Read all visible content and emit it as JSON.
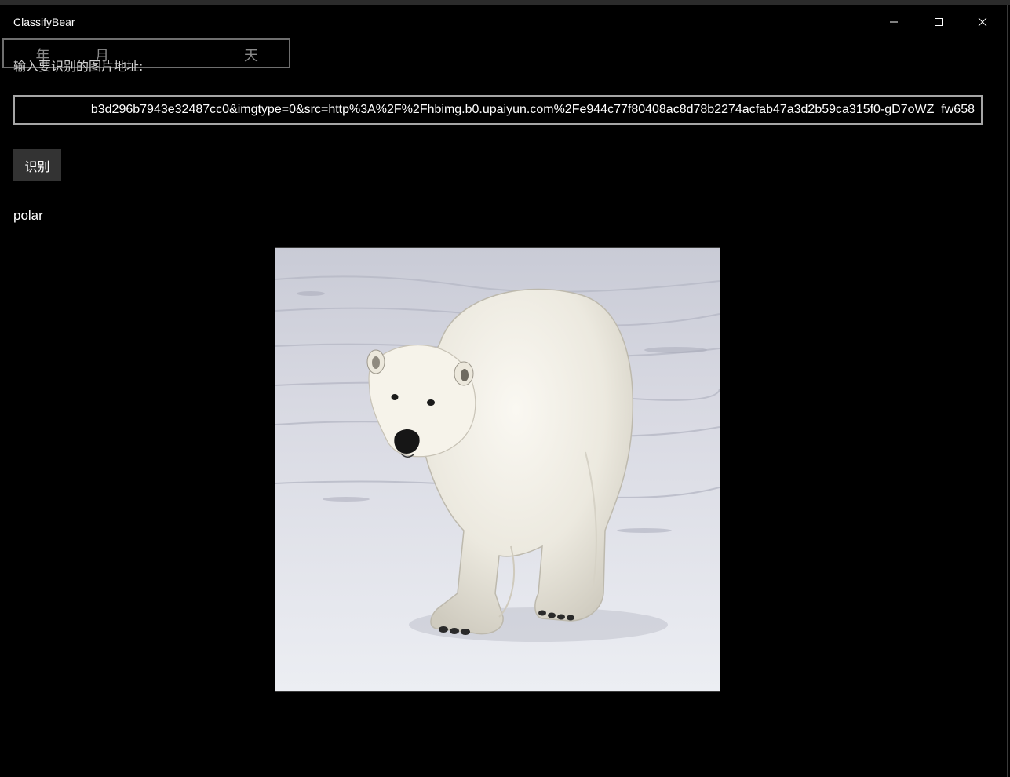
{
  "window": {
    "title": "ClassifyBear",
    "controls": {
      "minimize": "minimize-icon",
      "maximize": "maximize-icon",
      "close": "close-icon"
    }
  },
  "date_picker": {
    "year": "年",
    "month": "月",
    "day": "天"
  },
  "form": {
    "label": "输入要识别的图片地址:",
    "url_value": "b3d296b7943e32487cc0&imgtype=0&src=http%3A%2F%2Fhbimg.b0.upaiyun.com%2Fe944c77f80408ac8d78b2274acfab47a3d2b59ca315f0-gD7oWZ_fw658",
    "button": "识别",
    "result": "polar"
  },
  "image": {
    "subject": "polar bear walking on snow"
  }
}
